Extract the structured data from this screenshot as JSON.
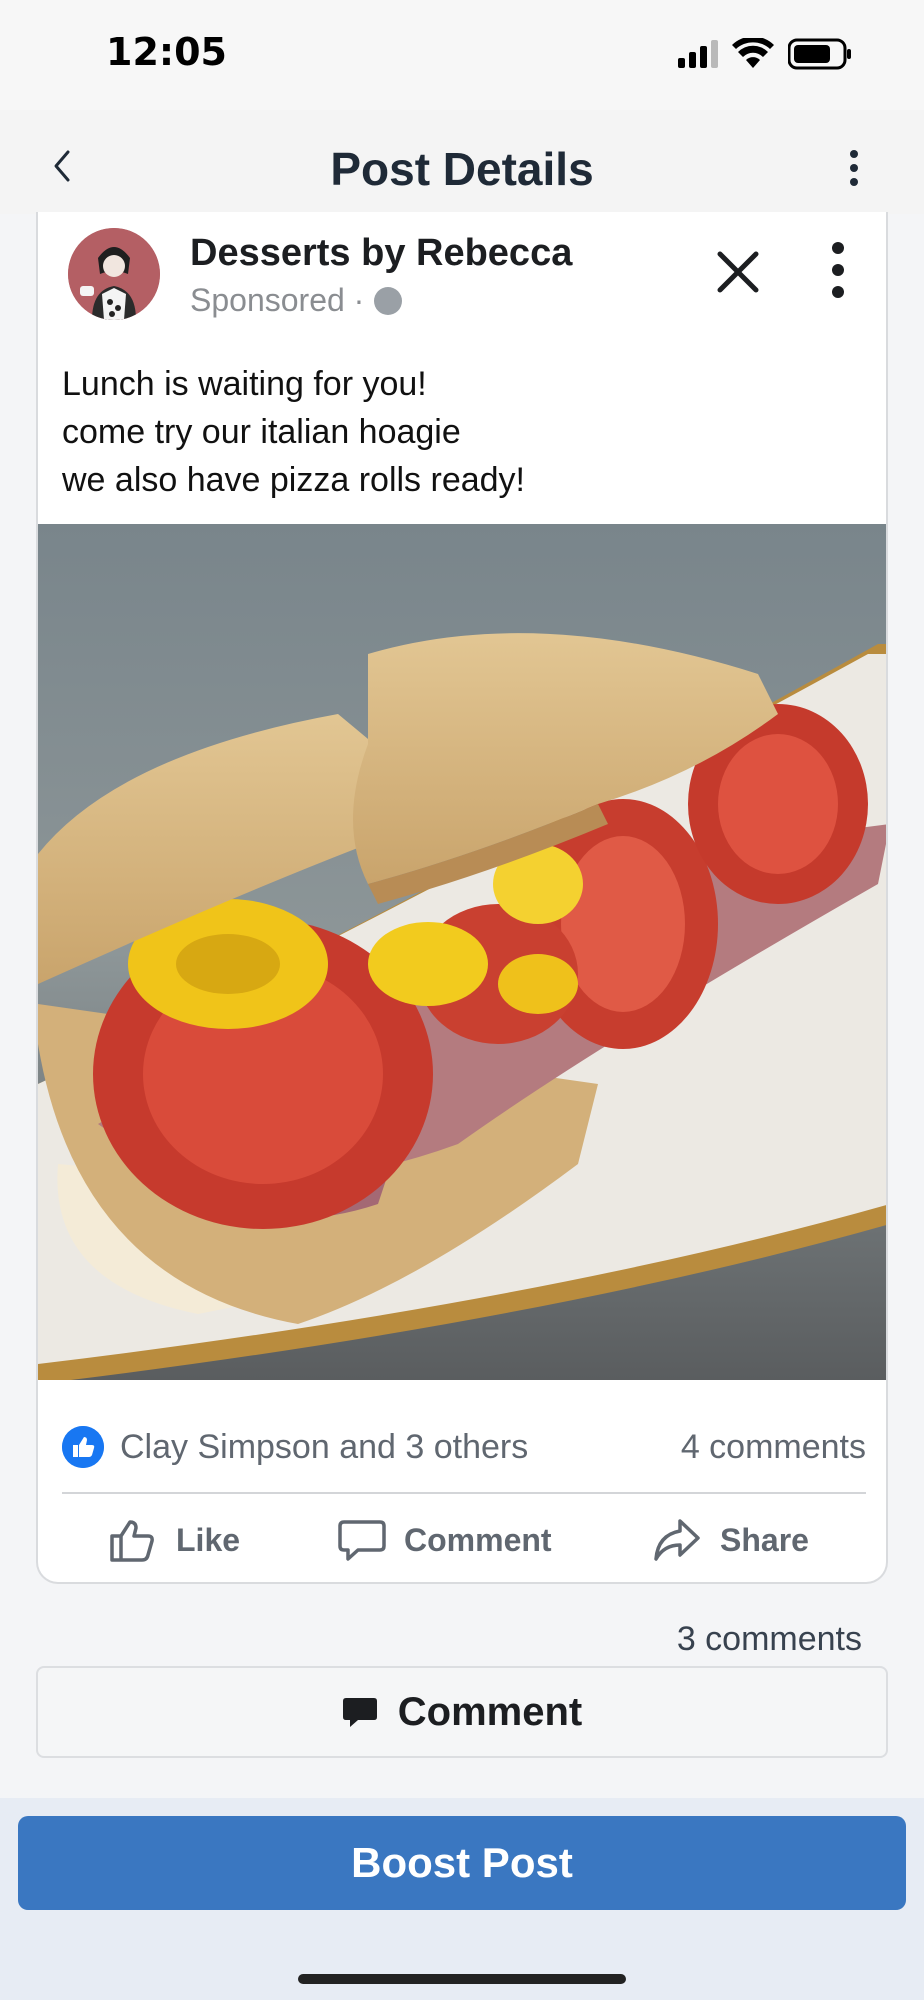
{
  "status_bar": {
    "time": "12:05"
  },
  "header": {
    "title": "Post Details"
  },
  "post": {
    "page_name": "Desserts by Rebecca",
    "sponsored": "Sponsored ·",
    "text_lines": [
      "Lunch is waiting for you!",
      "come try our italian hoagie",
      "we also have pizza rolls ready!"
    ],
    "reactions": "Clay Simpson and 3 others",
    "comments_count": "4 comments",
    "actions": {
      "like": "Like",
      "comment": "Comment",
      "share": "Share"
    }
  },
  "comments_summary": "3 comments",
  "comment_button": "Comment",
  "boost_button": "Boost Post",
  "colors": {
    "boost": "#3a77c1",
    "like_blue": "#1877f2"
  }
}
